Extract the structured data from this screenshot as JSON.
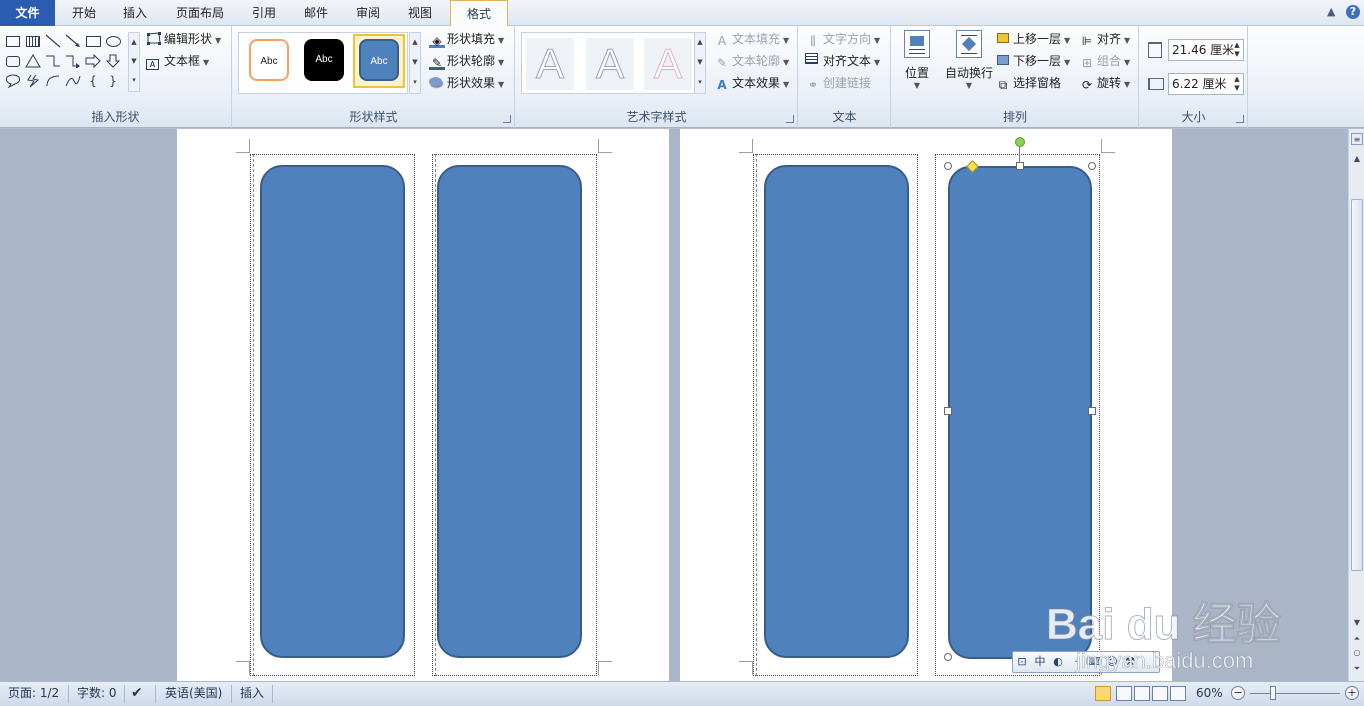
{
  "tabs": [
    {
      "label": "文件"
    },
    {
      "label": "开始"
    },
    {
      "label": "插入"
    },
    {
      "label": "页面布局"
    },
    {
      "label": "引用"
    },
    {
      "label": "邮件"
    },
    {
      "label": "审阅"
    },
    {
      "label": "视图"
    },
    {
      "label": "格式"
    }
  ],
  "ribbon": {
    "insert_shapes": {
      "label": "插入形状",
      "edit_shape": "编辑形状",
      "text_box": "文本框"
    },
    "shape_styles": {
      "label": "形状样式",
      "styles": [
        {
          "text": "Abc"
        },
        {
          "text": "Abc"
        },
        {
          "text": "Abc"
        }
      ],
      "fill": "形状填充",
      "outline": "形状轮廓",
      "effects": "形状效果"
    },
    "wordart": {
      "label": "艺术字样式",
      "samples": [
        "A",
        "A",
        "A"
      ],
      "text_fill": "文本填充",
      "text_outline": "文本轮廓",
      "text_effects": "文本效果"
    },
    "text": {
      "label": "文本",
      "direction": "文字方向",
      "align_text": "对齐文本",
      "create_link": "创建链接"
    },
    "arrange": {
      "label": "排列",
      "position": "位置",
      "wrap": "自动换行",
      "bring_forward": "上移一层",
      "send_backward": "下移一层",
      "selection_pane": "选择窗格",
      "align": "对齐",
      "group": "组合",
      "rotate": "旋转"
    },
    "size": {
      "label": "大小",
      "height": "21.46 厘米",
      "width": "6.22 厘米"
    }
  },
  "mini_toolbar": {
    "items": [
      "中"
    ]
  },
  "watermark": {
    "logo": "Bai du 经验",
    "url": "jingyan.baidu.com"
  },
  "status": {
    "page": "页面: 1/2",
    "words": "字数: 0",
    "language": "英语(美国)",
    "mode": "插入",
    "zoom": "60%"
  },
  "colors": {
    "shape_fill": "#4f81bd",
    "shape_outline": "#385d8a",
    "file_tab": "#2a5cb0"
  }
}
